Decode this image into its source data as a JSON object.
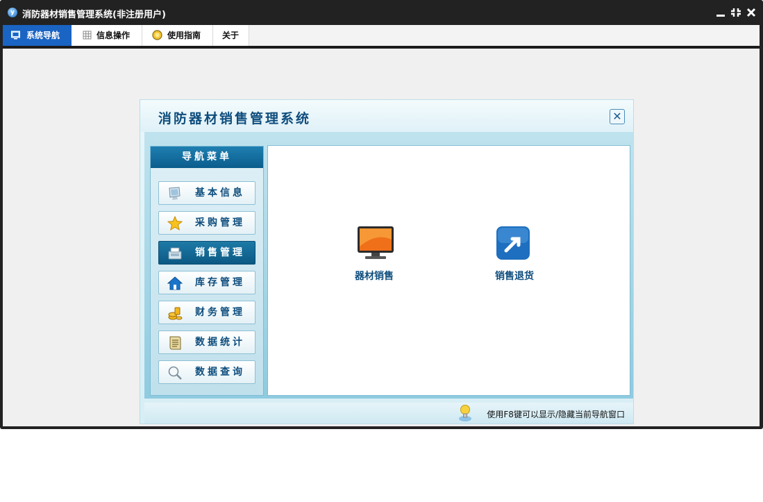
{
  "window": {
    "title": "消防器材销售管理系统(非注册用户)",
    "logo_letter": "y",
    "controls": {
      "minimize": "▁",
      "restore": "⛶",
      "close": "✕"
    }
  },
  "tabs": [
    {
      "label": "系统导航",
      "icon": "monitor-icon",
      "active": true
    },
    {
      "label": "信息操作",
      "icon": "grid-icon",
      "active": false
    },
    {
      "label": "使用指南",
      "icon": "coin-icon",
      "active": false
    },
    {
      "label": "关于",
      "icon": "",
      "active": false
    }
  ],
  "dialog": {
    "title": "消防器材销售管理系统",
    "close": "✕",
    "nav_header": "导航菜单",
    "nav_items": [
      {
        "label": "基本信息",
        "icon": "monitor-icon",
        "active": false
      },
      {
        "label": "采购管理",
        "icon": "star-icon",
        "active": false
      },
      {
        "label": "销售管理",
        "icon": "cash-register-icon",
        "active": true
      },
      {
        "label": "库存管理",
        "icon": "home-icon",
        "active": false
      },
      {
        "label": "财务管理",
        "icon": "coins-icon",
        "active": false
      },
      {
        "label": "数据统计",
        "icon": "document-icon",
        "active": false
      },
      {
        "label": "数据查询",
        "icon": "magnifier-icon",
        "active": false
      }
    ],
    "features": [
      {
        "label": "器材销售",
        "icon": "display-icon"
      },
      {
        "label": "销售退货",
        "icon": "return-arrow-icon"
      }
    ],
    "footer_tip": "使用F8键可以显示/隐藏当前导航窗口"
  },
  "colors": {
    "accent": "#1a64c4",
    "nav_active": "#0b5a84",
    "text_blue": "#0e4d7d"
  }
}
